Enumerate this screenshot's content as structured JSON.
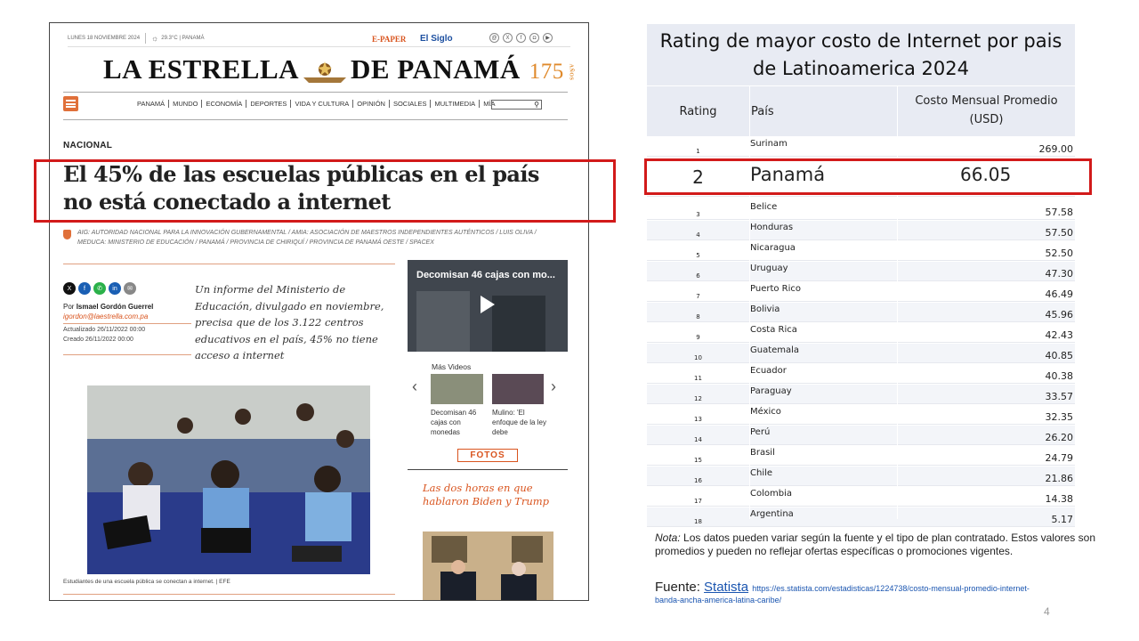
{
  "newspaper": {
    "date": "LUNES 18 NOVIEMBRE 2024",
    "weather": "29.3°C | PANAMÁ",
    "epaper": "E-PAPER",
    "siglo": "El Siglo",
    "masthead_left": "LA ESTRELLA",
    "masthead_right": "DE PANAMÁ",
    "anniversary": "175",
    "anniversary_label": "AÑOS",
    "nav": [
      "PANAMÁ",
      "MUNDO",
      "ECONOMÍA",
      "DEPORTES",
      "VIDA Y CULTURA",
      "OPINIÓN",
      "SOCIALES",
      "MULTIMEDIA",
      "MÍA"
    ],
    "section": "NACIONAL",
    "headline": "El 45% de las escuelas públicas en el país no está conectado a internet",
    "tags": "AIG: AUTORIDAD NACIONAL PARA LA INNOVACIÓN GUBERNAMENTAL / AMIA: ASOCIACIÓN DE MAESTROS INDEPENDIENTES AUTÉNTICOS / LUIS OLIVA / MEDUCA: MINISTERIO DE EDUCACIÓN / PANAMÁ / PROVINCIA DE CHIRIQUÍ / PROVINCIA DE PANAMÁ OESTE / SPACEX",
    "author_prefix": "Por",
    "author": "Ismael Gordón Guerrel",
    "author_email": "igordon@laestrella.com.pa",
    "updated": "Actualizado 26/11/2022 00:00",
    "created": "Creado 26/11/2022 00:00",
    "lede": "Un informe del Ministerio de Educación, divulgado en noviembre, precisa que de los 3.122 centros educativos en el país, 45% no tiene acceso a internet",
    "photo_caption": "Estudiantes de una escuela pública se conectan a internet. | EFE",
    "video_title": "Decomisan 46 cajas con mo...",
    "more_videos": "Más Videos",
    "video1_caption": "Decomisan 46 cajas con monedas",
    "video2_caption": "Mulino: 'El enfoque de la ley debe",
    "fotos": "FOTOS",
    "related": "Las dos horas en que hablaron Biden y Trump"
  },
  "table": {
    "title": "Rating de mayor costo de Internet por pais de Latinoamerica  2024",
    "headers": {
      "rank": "Rating",
      "country": "País",
      "cost": "Costo Mensual Promedio (USD)"
    },
    "rows": [
      {
        "rank": "1",
        "country": "Surinam",
        "cost": "269.00"
      },
      {
        "rank": "2",
        "country": "Panamá",
        "cost": "66.05",
        "highlight": true
      },
      {
        "rank": "3",
        "country": "Belice",
        "cost": "57.58"
      },
      {
        "rank": "4",
        "country": "Honduras",
        "cost": "57.50"
      },
      {
        "rank": "5",
        "country": "Nicaragua",
        "cost": "52.50"
      },
      {
        "rank": "6",
        "country": "Uruguay",
        "cost": "47.30"
      },
      {
        "rank": "7",
        "country": "Puerto Rico",
        "cost": "46.49"
      },
      {
        "rank": "8",
        "country": "Bolivia",
        "cost": "45.96"
      },
      {
        "rank": "9",
        "country": "Costa Rica",
        "cost": "42.43"
      },
      {
        "rank": "10",
        "country": "Guatemala",
        "cost": "40.85"
      },
      {
        "rank": "11",
        "country": "Ecuador",
        "cost": "40.38"
      },
      {
        "rank": "12",
        "country": "Paraguay",
        "cost": "33.57"
      },
      {
        "rank": "13",
        "country": "México",
        "cost": "32.35"
      },
      {
        "rank": "14",
        "country": "Perú",
        "cost": "26.20"
      },
      {
        "rank": "15",
        "country": "Brasil",
        "cost": "24.79"
      },
      {
        "rank": "16",
        "country": "Chile",
        "cost": "21.86"
      },
      {
        "rank": "17",
        "country": "Colombia",
        "cost": "14.38"
      },
      {
        "rank": "18",
        "country": "Argentina",
        "cost": "5.17"
      }
    ]
  },
  "note": {
    "label": "Nota:",
    "text": " Los datos pueden variar según la fuente y el tipo de plan contratado. Estos valores son promedios y pueden no reflejar ofertas específicas o promociones vigentes."
  },
  "source": {
    "label": "Fuente: ",
    "link": "Statista",
    "url_a": "https://es.statista.com/estadisticas/1224738/costo-mensual-promedio-internet-",
    "url_b": "banda-ancha-america-latina-caribe/"
  },
  "page_number": "4",
  "colors": {
    "highlight_red": "#d21a1a",
    "brand_orange": "#d9541e",
    "table_bg": "#e8ebf3"
  }
}
